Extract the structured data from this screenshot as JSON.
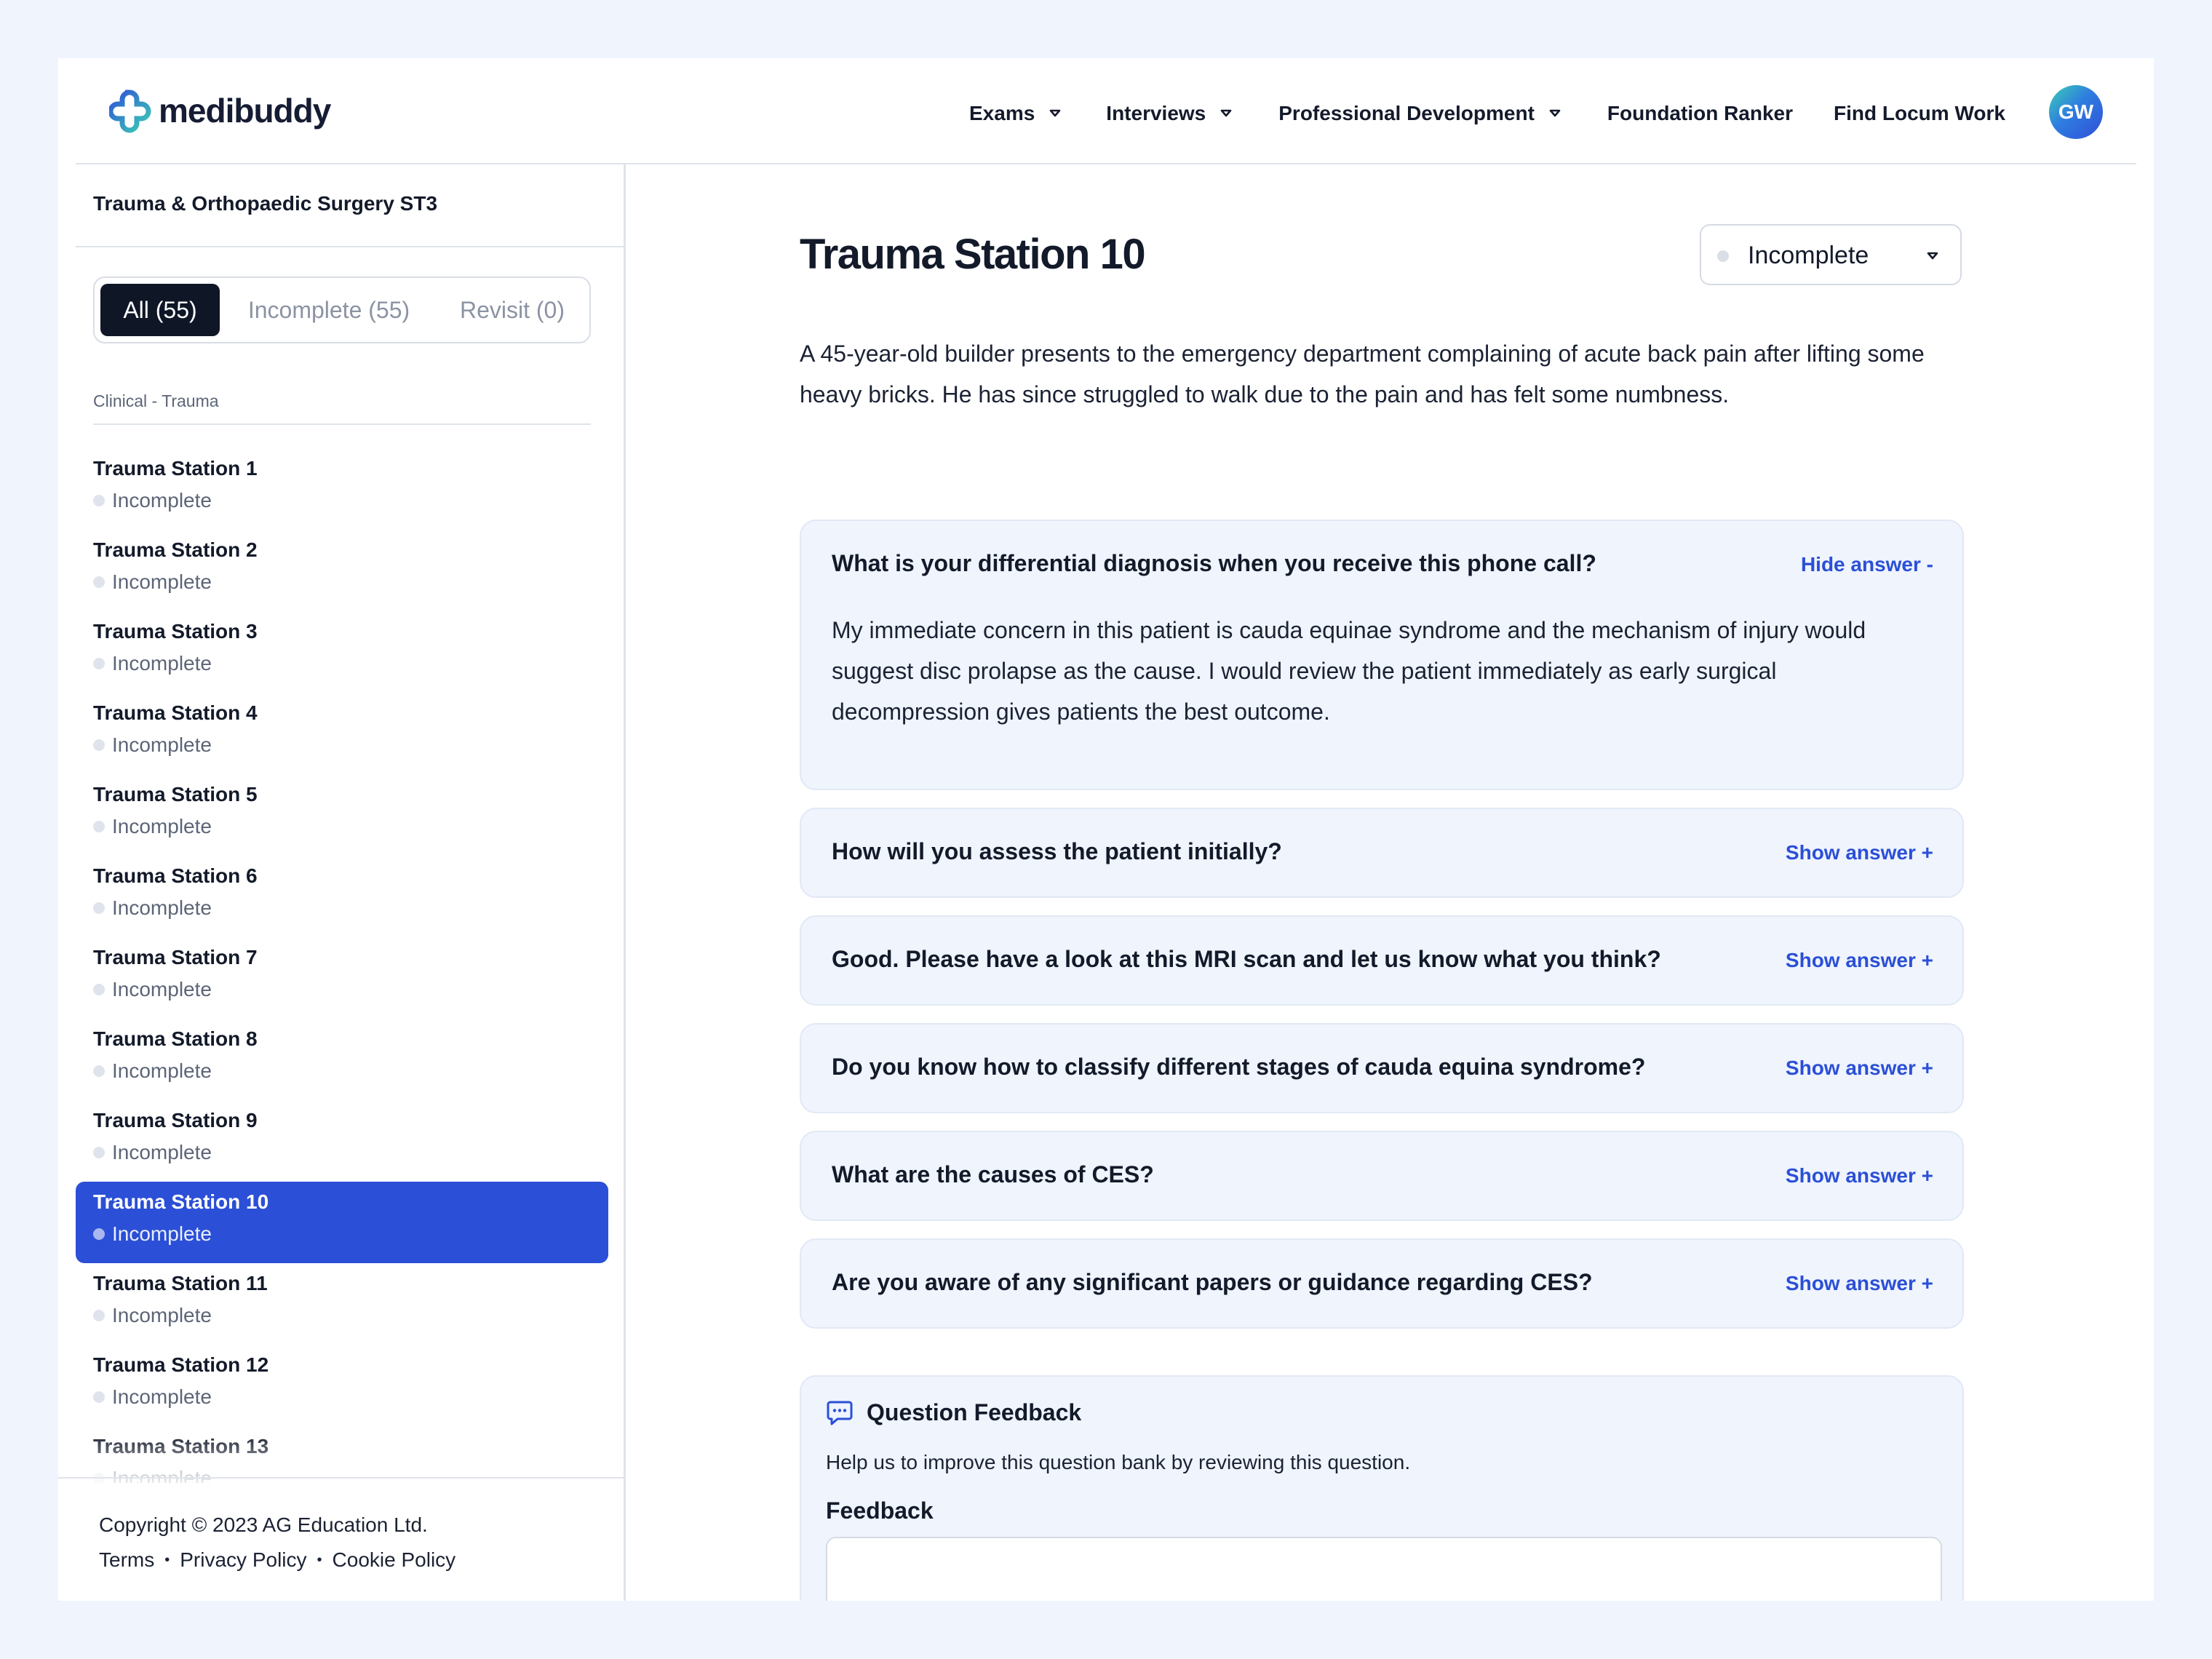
{
  "header": {
    "logo_text": "medibuddy",
    "nav": [
      {
        "label": "Exams",
        "has_dropdown": true
      },
      {
        "label": "Interviews",
        "has_dropdown": true
      },
      {
        "label": "Professional Development",
        "has_dropdown": true
      },
      {
        "label": "Foundation Ranker",
        "has_dropdown": false
      },
      {
        "label": "Find Locum Work",
        "has_dropdown": false
      }
    ],
    "avatar_initials": "GW"
  },
  "sidebar": {
    "course_title": "Trauma & Orthopaedic Surgery ST3",
    "filters": [
      {
        "label": "All (55)",
        "active": true
      },
      {
        "label": "Incomplete (55)",
        "active": false
      },
      {
        "label": "Revisit (0)",
        "active": false
      }
    ],
    "group_label": "Clinical - Trauma",
    "stations": [
      {
        "name": "Trauma Station 1",
        "status": "Incomplete"
      },
      {
        "name": "Trauma Station 2",
        "status": "Incomplete"
      },
      {
        "name": "Trauma Station 3",
        "status": "Incomplete"
      },
      {
        "name": "Trauma Station 4",
        "status": "Incomplete"
      },
      {
        "name": "Trauma Station 5",
        "status": "Incomplete"
      },
      {
        "name": "Trauma Station 6",
        "status": "Incomplete"
      },
      {
        "name": "Trauma Station 7",
        "status": "Incomplete"
      },
      {
        "name": "Trauma Station 8",
        "status": "Incomplete"
      },
      {
        "name": "Trauma Station 9",
        "status": "Incomplete"
      },
      {
        "name": "Trauma Station 10",
        "status": "Incomplete",
        "active": true
      },
      {
        "name": "Trauma Station 11",
        "status": "Incomplete"
      },
      {
        "name": "Trauma Station 12",
        "status": "Incomplete"
      },
      {
        "name": "Trauma Station 13",
        "status": "Incomplete"
      }
    ],
    "footer": {
      "copyright": "Copyright © 2023 AG Education Ltd.",
      "links": [
        "Terms",
        "Privacy Policy",
        "Cookie Policy"
      ],
      "separator": "•"
    }
  },
  "main": {
    "title": "Trauma Station 10",
    "status_select": {
      "value": "Incomplete"
    },
    "scenario": "A 45-year-old builder presents to the emergency department complaining of acute back pain after lifting some heavy bricks. He has since struggled to walk due to the pain and has felt some numbness.",
    "questions": [
      {
        "question": "What is your differential diagnosis when you receive this phone call?",
        "toggle": "Hide answer -",
        "expanded": true,
        "answer": "My immediate concern in this patient is cauda equinae syndrome and the mechanism of injury would suggest disc prolapse as the cause. I would review the patient immediately as early surgical decompression gives patients the best outcome."
      },
      {
        "question": "How will you assess the patient initially?",
        "toggle": "Show answer +",
        "expanded": false
      },
      {
        "question": "Good. Please have a look at this MRI scan and let us know what you think?",
        "toggle": "Show answer +",
        "expanded": false
      },
      {
        "question": "Do you know how to classify different stages of cauda equina syndrome?",
        "toggle": "Show answer +",
        "expanded": false
      },
      {
        "question": "What are the causes of CES?",
        "toggle": "Show answer +",
        "expanded": false
      },
      {
        "question": "Are you aware of any significant papers or guidance regarding CES?",
        "toggle": "Show answer +",
        "expanded": false
      }
    ],
    "feedback": {
      "title": "Question Feedback",
      "help": "Help us to improve this question bank by reviewing this question.",
      "label": "Feedback",
      "value": ""
    }
  },
  "colors": {
    "accent": "#2b4fd6",
    "background": "#eff4fd",
    "dark_pill": "#0f1626",
    "status_dot": "#dfe4ec"
  },
  "icons": [
    "medibuddy-logo-icon",
    "caret-down-icon",
    "chat-bubble-icon"
  ]
}
